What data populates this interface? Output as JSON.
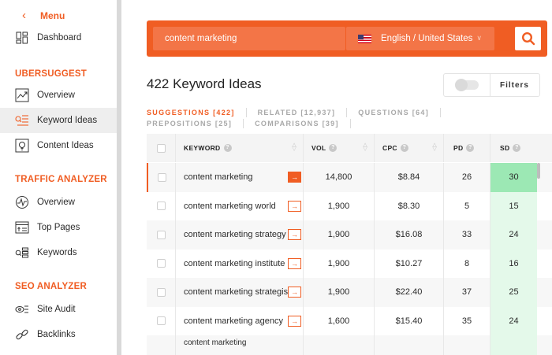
{
  "sidebar": {
    "menu_label": "Menu",
    "dashboard": "Dashboard",
    "sections": [
      {
        "heading": "UBERSUGGEST",
        "items": [
          "Overview",
          "Keyword Ideas",
          "Content Ideas"
        ]
      },
      {
        "heading": "TRAFFIC ANALYZER",
        "items": [
          "Overview",
          "Top Pages",
          "Keywords"
        ]
      },
      {
        "heading": "SEO ANALYZER",
        "items": [
          "Site Audit",
          "Backlinks"
        ]
      }
    ],
    "active_item": "Keyword Ideas"
  },
  "search": {
    "query": "content marketing",
    "language": "English / United States"
  },
  "results": {
    "title": "422 Keyword Ideas",
    "filters_label": "Filters",
    "tabs": [
      "SUGGESTIONS [422]",
      "RELATED [12,937]",
      "QUESTIONS [64]",
      "PREPOSITIONS [25]",
      "COMPARISONS [39]"
    ],
    "active_tab": "SUGGESTIONS [422]"
  },
  "table": {
    "headers": {
      "keyword": "KEYWORD",
      "vol": "VOL",
      "cpc": "CPC",
      "pd": "PD",
      "sd": "SD"
    },
    "rows": [
      {
        "keyword": "content marketing",
        "vol": "14,800",
        "cpc": "$8.84",
        "pd": "26",
        "sd": "30"
      },
      {
        "keyword": "content marketing world",
        "vol": "1,900",
        "cpc": "$8.30",
        "pd": "5",
        "sd": "15"
      },
      {
        "keyword": "content marketing strategy",
        "vol": "1,900",
        "cpc": "$16.08",
        "pd": "33",
        "sd": "24"
      },
      {
        "keyword": "content marketing institute",
        "vol": "1,900",
        "cpc": "$10.27",
        "pd": "8",
        "sd": "16"
      },
      {
        "keyword": "content marketing strategist",
        "vol": "1,900",
        "cpc": "$22.40",
        "pd": "37",
        "sd": "25"
      },
      {
        "keyword": "content marketing agency",
        "vol": "1,600",
        "cpc": "$15.40",
        "pd": "35",
        "sd": "24"
      }
    ],
    "partial_row_keyword": "content marketing"
  },
  "colors": {
    "accent": "#f05d23",
    "sd_strong": "#9ce8b4",
    "sd_light": "#e4f9ea"
  }
}
